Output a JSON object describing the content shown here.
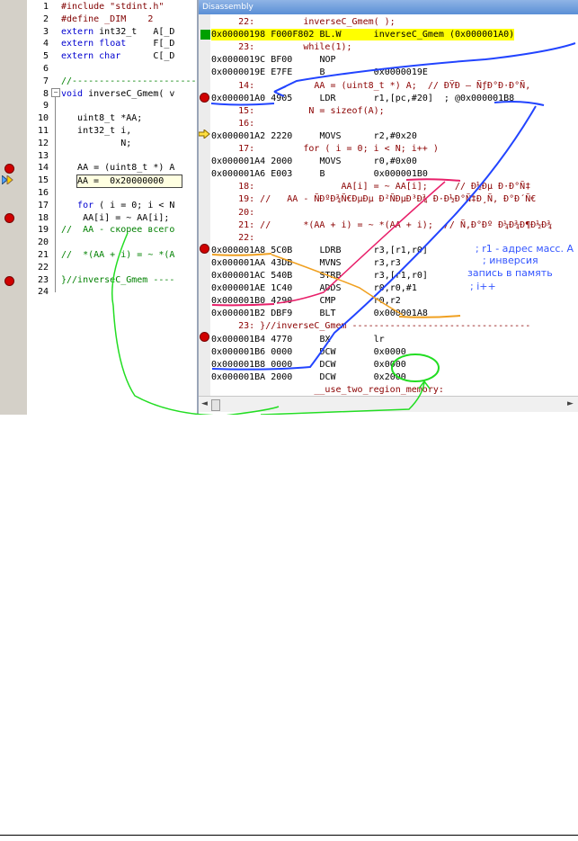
{
  "editor": {
    "lines": [
      {
        "num": "1",
        "parts": [
          {
            "t": "#include \"stdint.h\"",
            "c": "pp"
          }
        ]
      },
      {
        "num": "2",
        "parts": [
          {
            "t": "#define _DIM    2",
            "c": "pp"
          }
        ]
      },
      {
        "num": "3",
        "parts": [
          {
            "t": "extern ",
            "c": "kw"
          },
          {
            "t": "int32_t   A[_D",
            "c": ""
          }
        ]
      },
      {
        "num": "4",
        "parts": [
          {
            "t": "extern ",
            "c": "kw"
          },
          {
            "t": "float",
            "c": "kw"
          },
          {
            "t": "     F[_D",
            "c": ""
          }
        ]
      },
      {
        "num": "5",
        "parts": [
          {
            "t": "extern ",
            "c": "kw"
          },
          {
            "t": "char",
            "c": "kw"
          },
          {
            "t": "      C[_D",
            "c": ""
          }
        ]
      },
      {
        "num": "6",
        "parts": []
      },
      {
        "num": "7",
        "parts": [
          {
            "t": "//-------------------------",
            "c": "cm"
          }
        ]
      },
      {
        "num": "8",
        "parts": [
          {
            "t": "void",
            "c": "kw"
          },
          {
            "t": " inverseC_Gmem( v",
            "c": ""
          }
        ]
      },
      {
        "num": "9",
        "parts": []
      },
      {
        "num": "10",
        "parts": [
          {
            "t": "   uint8_t *AA;",
            "c": ""
          }
        ]
      },
      {
        "num": "11",
        "parts": [
          {
            "t": "   int32_t i,",
            "c": ""
          }
        ]
      },
      {
        "num": "12",
        "parts": [
          {
            "t": "           N;",
            "c": ""
          }
        ]
      },
      {
        "num": "13",
        "parts": []
      },
      {
        "num": "14",
        "parts": [
          {
            "t": "   AA = (uint8_t *) A",
            "c": ""
          }
        ]
      },
      {
        "num": "15",
        "parts": []
      },
      {
        "num": "16",
        "parts": []
      },
      {
        "num": "17",
        "parts": [
          {
            "t": "   for",
            "c": "kw"
          },
          {
            "t": " ( i = 0; i < N",
            "c": ""
          }
        ]
      },
      {
        "num": "18",
        "parts": [
          {
            "t": "    AA[i] = ~ AA[i];",
            "c": ""
          }
        ]
      },
      {
        "num": "19",
        "parts": [
          {
            "t": "//  AA - скорее всего",
            "c": "cm"
          }
        ]
      },
      {
        "num": "20",
        "parts": []
      },
      {
        "num": "21",
        "parts": [
          {
            "t": "//  *(AA + i) = ~ *(A",
            "c": "cm"
          }
        ]
      },
      {
        "num": "22",
        "parts": []
      },
      {
        "num": "23",
        "parts": [
          {
            "t": "}//inverseC_Gmem ----",
            "c": "cm"
          }
        ]
      },
      {
        "num": "24",
        "parts": []
      }
    ],
    "hint": "AA =  0x20000000",
    "fold_symbol": "−"
  },
  "disassembly": {
    "title": "Disassembly",
    "scroll_left": "◄",
    "scroll_right": "►",
    "lines": [
      {
        "addr": "",
        "code": "",
        "mnem": "",
        "text": "     22:         inverseC_Gmem( );",
        "src": true
      },
      {
        "addr": "0x00000198",
        "code": "F000F802",
        "mnem": "BL.W",
        "text": "      inverseC_Gmem (0x000001A0)",
        "src": false,
        "current": true
      },
      {
        "addr": "",
        "code": "",
        "mnem": "",
        "text": "     23:         while(1);",
        "src": true
      },
      {
        "addr": "0x0000019C",
        "code": "BF00",
        "mnem": "NOP",
        "text": "",
        "src": false
      },
      {
        "addr": "0x0000019E",
        "code": "E7FE",
        "mnem": "B",
        "text": "         0x0000019E",
        "src": false
      },
      {
        "addr": "",
        "code": "",
        "mnem": "",
        "text": "     14:           AA = (uint8_t *) A;  // ÐŸÐ – ÑƒÐ°Ð·Ð°Ñ‚",
        "src": true
      },
      {
        "addr": "0x000001A0",
        "code": "4905",
        "mnem": "LDR",
        "text": "       r1,[pc,#20]  ; @0x000001B8",
        "src": false
      },
      {
        "addr": "",
        "code": "",
        "mnem": "",
        "text": "     15:          N = sizeof(A);",
        "src": true
      },
      {
        "addr": "",
        "code": "",
        "mnem": "",
        "text": "     16:",
        "src": true
      },
      {
        "addr": "0x000001A2",
        "code": "2220",
        "mnem": "MOVS",
        "text": "      r2,#0x20",
        "src": false
      },
      {
        "addr": "",
        "code": "",
        "mnem": "",
        "text": "     17:         for ( i = 0; i < N; i++ )",
        "src": true
      },
      {
        "addr": "0x000001A4",
        "code": "2000",
        "mnem": "MOVS",
        "text": "      r0,#0x00",
        "src": false
      },
      {
        "addr": "0x000001A6",
        "code": "E003",
        "mnem": "B",
        "text": "         0x000001B0",
        "src": false
      },
      {
        "addr": "",
        "code": "",
        "mnem": "",
        "text": "     18:                AA[i] = ~ AA[i];     // Ð½Ðµ Ð·Ð°Ñ‡",
        "src": true
      },
      {
        "addr": "",
        "code": "",
        "mnem": "",
        "text": "     19: //   AA - ÑÐºÐ¾Ñ€ÐµÐµ Ð²ÑÐµÐ³Ð¾ Ð·Ð½Ð°Ñ‡Ð¸Ñ‚ Ð°Ð´Ñ€",
        "src": true
      },
      {
        "addr": "",
        "code": "",
        "mnem": "",
        "text": "     20:",
        "src": true
      },
      {
        "addr": "",
        "code": "",
        "mnem": "",
        "text": "     21: //      *(AA + i) = ~ *(AA + i);  // Ñ‚Ð°Ðº Ð¼Ð¾Ð¶Ð½Ð¾",
        "src": true
      },
      {
        "addr": "",
        "code": "",
        "mnem": "",
        "text": "     22:",
        "src": true
      },
      {
        "addr": "0x000001A8",
        "code": "5C0B",
        "mnem": "LDRB",
        "text": "      r3,[r1,r0]",
        "src": false
      },
      {
        "addr": "0x000001AA",
        "code": "43DB",
        "mnem": "MVNS",
        "text": "      r3,r3",
        "src": false
      },
      {
        "addr": "0x000001AC",
        "code": "540B",
        "mnem": "STRB",
        "text": "      r3,[r1,r0]",
        "src": false
      },
      {
        "addr": "0x000001AE",
        "code": "1C40",
        "mnem": "ADDS",
        "text": "      r0,r0,#1",
        "src": false
      },
      {
        "addr": "0x000001B0",
        "code": "4290",
        "mnem": "CMP",
        "text": "       r0,r2",
        "src": false
      },
      {
        "addr": "0x000001B2",
        "code": "DBF9",
        "mnem": "BLT",
        "text": "       0x000001A8",
        "src": false
      },
      {
        "addr": "",
        "code": "",
        "mnem": "",
        "text": "     23: }//inverseC_Gmem ---------------------------------",
        "src": true
      },
      {
        "addr": "0x000001B4",
        "code": "4770",
        "mnem": "BX",
        "text": "        lr",
        "src": false
      },
      {
        "addr": "0x000001B6",
        "code": "0000",
        "mnem": "DCW",
        "text": "       0x0000",
        "src": false
      },
      {
        "addr": "0x000001B8",
        "code": "0000",
        "mnem": "DCW",
        "text": "       0x0000",
        "src": false
      },
      {
        "addr": "0x000001BA",
        "code": "2000",
        "mnem": "DCW",
        "text": "       0x2000",
        "src": false
      },
      {
        "addr": "",
        "code": "",
        "mnem": "",
        "text": "                   __use_two_region_memory:",
        "src": true
      }
    ]
  },
  "annotations": {
    "r1_note": "; r1 - адрес масс. A",
    "inversion_note": "; инверсия",
    "write_note": "запись в память",
    "inc_note": "; i++"
  },
  "colors": {
    "annotation_blue": "#2244ff",
    "annotation_green": "#22dd22",
    "annotation_pink": "#e8206a",
    "annotation_orange": "#f0a020",
    "current_line": "#ffff00",
    "breakpoint": "#d00000"
  }
}
